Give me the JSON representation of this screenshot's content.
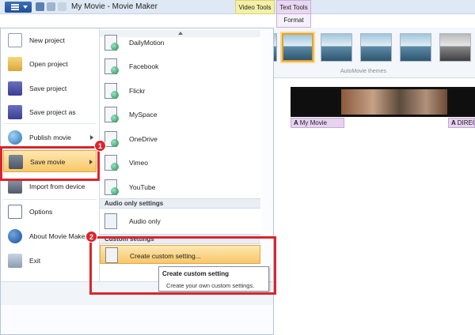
{
  "window": {
    "title": "My Movie - Movie Maker"
  },
  "contextual_tabs": {
    "video_tools": "Video Tools",
    "text_tools": "Text Tools",
    "format_tab": "Format"
  },
  "ribbon": {
    "group_label": "AutoMovie themes"
  },
  "storyboard": {
    "caption_1": "My Movie",
    "caption_2": "DIREC"
  },
  "app_menu": {
    "items": [
      {
        "label": "New project",
        "icon": "new-project-icon"
      },
      {
        "label": "Open project",
        "icon": "open-folder-icon"
      },
      {
        "label": "Save project",
        "icon": "save-disk-icon"
      },
      {
        "label": "Save project as",
        "icon": "save-as-icon"
      },
      {
        "label": "Publish movie",
        "icon": "globe-publish-icon"
      },
      {
        "label": "Save movie",
        "icon": "film-save-icon"
      },
      {
        "label": "Import from device",
        "icon": "import-device-icon"
      },
      {
        "label": "Options",
        "icon": "options-icon"
      },
      {
        "label": "About Movie Maker",
        "icon": "info-icon"
      },
      {
        "label": "Exit",
        "icon": "exit-icon"
      }
    ]
  },
  "save_submenu": {
    "items": [
      "DailyMotion",
      "Facebook",
      "Flickr",
      "MySpace",
      "OneDrive",
      "Vimeo",
      "YouTube"
    ],
    "audio_header": "Audio only settings",
    "audio_item": "Audio only",
    "custom_header": "Custom settings",
    "custom_item": "Create custom setting..."
  },
  "tooltip": {
    "title": "Create custom setting",
    "body": "Create your own custom settings."
  },
  "annotations": {
    "step_1": "1",
    "step_2": "2",
    "highlight_color": "#d9262c"
  }
}
